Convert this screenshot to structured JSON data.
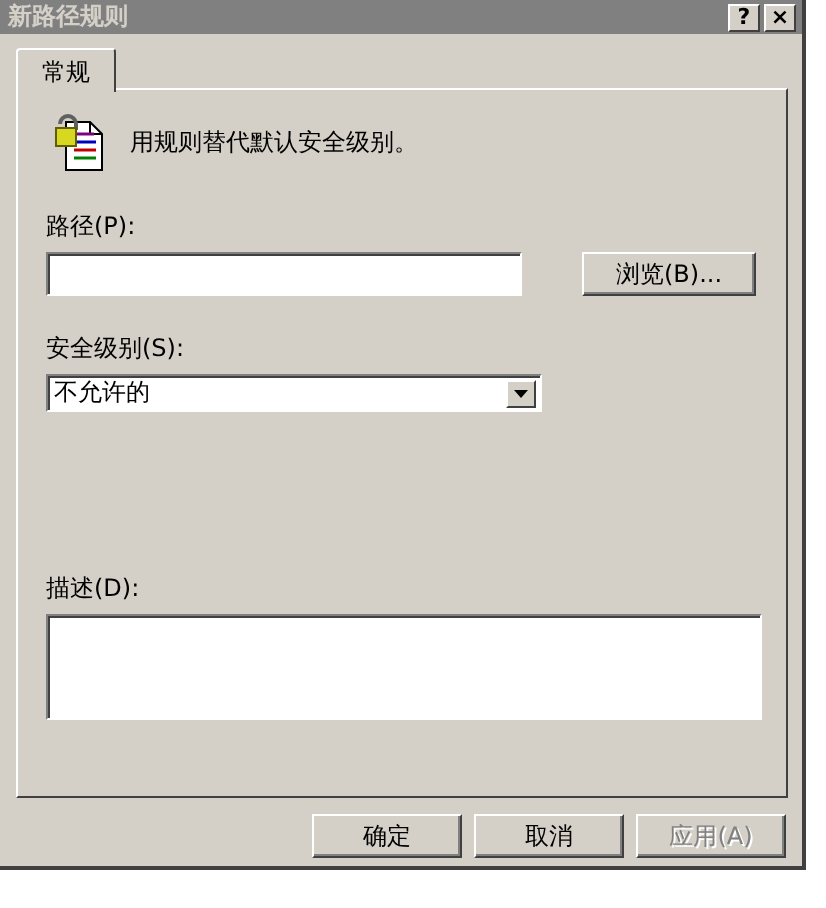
{
  "window": {
    "title": "新路径规则",
    "title_buttons": [
      "?",
      "×"
    ]
  },
  "tabs": [
    {
      "label": "常规",
      "selected": true
    }
  ],
  "intro": "用规则替代默认安全级别。",
  "path": {
    "label": "路径(P):",
    "browse": "浏览(B)..."
  },
  "security_level": {
    "label": "安全级别(S):",
    "value": "不允许的"
  },
  "description": {
    "label": "描述(D):"
  },
  "buttons": [
    {
      "label": "确定",
      "disabled": false
    },
    {
      "label": "取消",
      "disabled": false
    },
    {
      "label": "应用(A)",
      "disabled": true
    }
  ]
}
